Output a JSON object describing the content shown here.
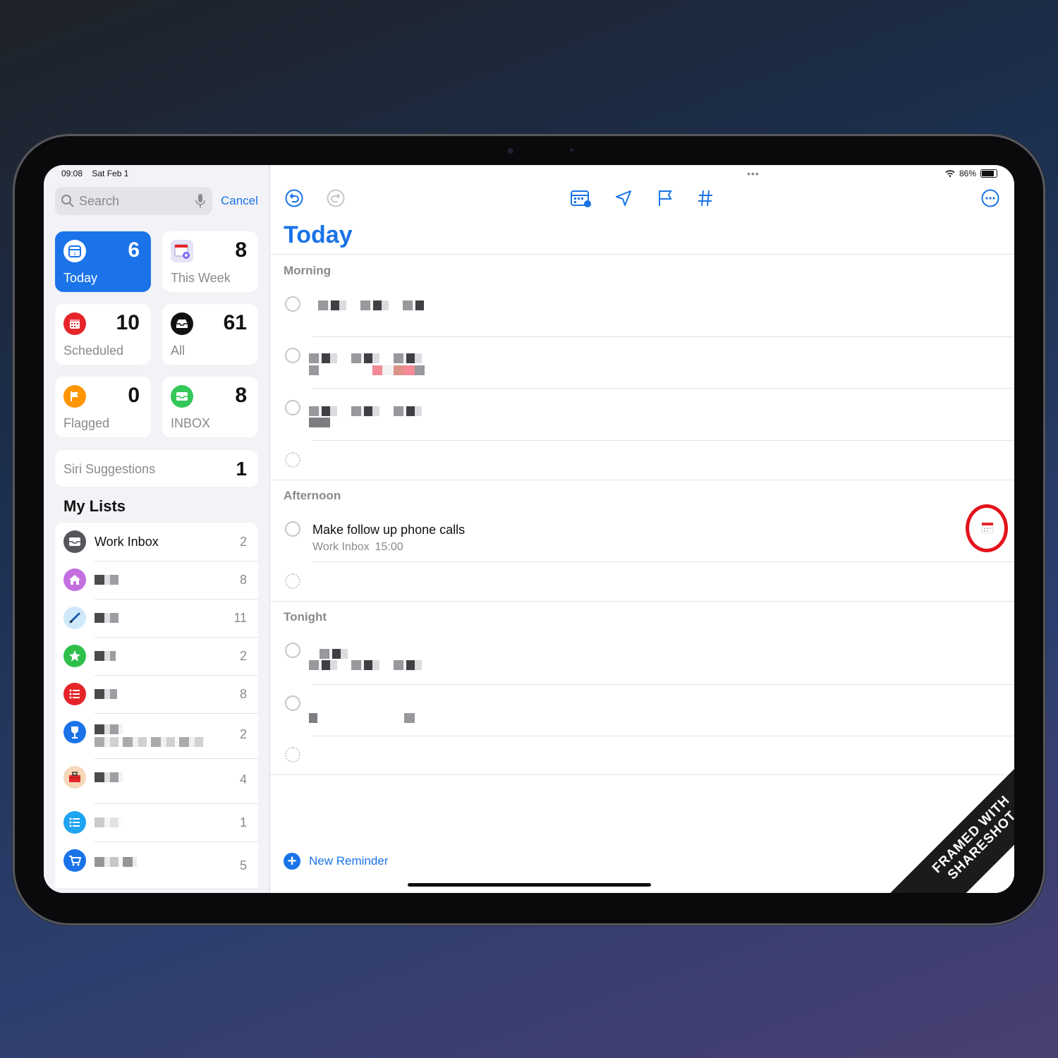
{
  "status": {
    "time": "09:08",
    "date": "Sat Feb 1",
    "battery": "86%"
  },
  "sidebar": {
    "search_placeholder": "Search",
    "cancel_label": "Cancel",
    "smart_lists": [
      {
        "label": "Today",
        "count": "6",
        "icon": "calendar-day-icon",
        "color": "#1a73e8"
      },
      {
        "label": "This Week",
        "count": "8",
        "icon": "calendar-week-icon",
        "color": "#7b6cf6"
      },
      {
        "label": "Scheduled",
        "count": "10",
        "icon": "calendar-icon",
        "color": "#e5252a"
      },
      {
        "label": "All",
        "count": "61",
        "icon": "tray-icon",
        "color": "#111111"
      },
      {
        "label": "Flagged",
        "count": "0",
        "icon": "flag-icon",
        "color": "#ff9500"
      },
      {
        "label": "INBOX",
        "count": "8",
        "icon": "inbox-icon",
        "color": "#34c759"
      }
    ],
    "siri": {
      "label": "Siri Suggestions",
      "count": "1"
    },
    "my_lists_title": "My Lists",
    "lists": [
      {
        "name": "Work Inbox",
        "count": "2",
        "icon": "tray-icon",
        "color": "#55565c"
      },
      {
        "name": "",
        "count": "8",
        "icon": "house-icon",
        "color": "#c36fe0"
      },
      {
        "name": "",
        "count": "11",
        "icon": "pencil-icon",
        "color": "#9fd7f7"
      },
      {
        "name": "",
        "count": "2",
        "icon": "star-icon",
        "color": "#2fbf4b"
      },
      {
        "name": "",
        "count": "8",
        "icon": "list-icon",
        "color": "#e5252a"
      },
      {
        "name": "",
        "count": "2",
        "icon": "wineglass-icon",
        "color": "#1a73e8"
      },
      {
        "name": "",
        "count": "4",
        "icon": "toolbox-icon",
        "color": "#f6d7b8"
      },
      {
        "name": "",
        "count": "1",
        "icon": "list-icon",
        "color": "#1fa4f2"
      },
      {
        "name": "",
        "count": "5",
        "icon": "cart-icon",
        "color": "#1a73e8"
      }
    ]
  },
  "main": {
    "title": "Today",
    "sections": {
      "morning": "Morning",
      "afternoon": "Afternoon",
      "tonight": "Tonight"
    },
    "afternoon_task": {
      "title": "Make follow up phone calls",
      "list": "Work Inbox",
      "time": "15:00"
    },
    "new_reminder": "New Reminder"
  },
  "ribbon": {
    "line1": "FRAMED WITH",
    "line2": "SHARESHOT"
  }
}
